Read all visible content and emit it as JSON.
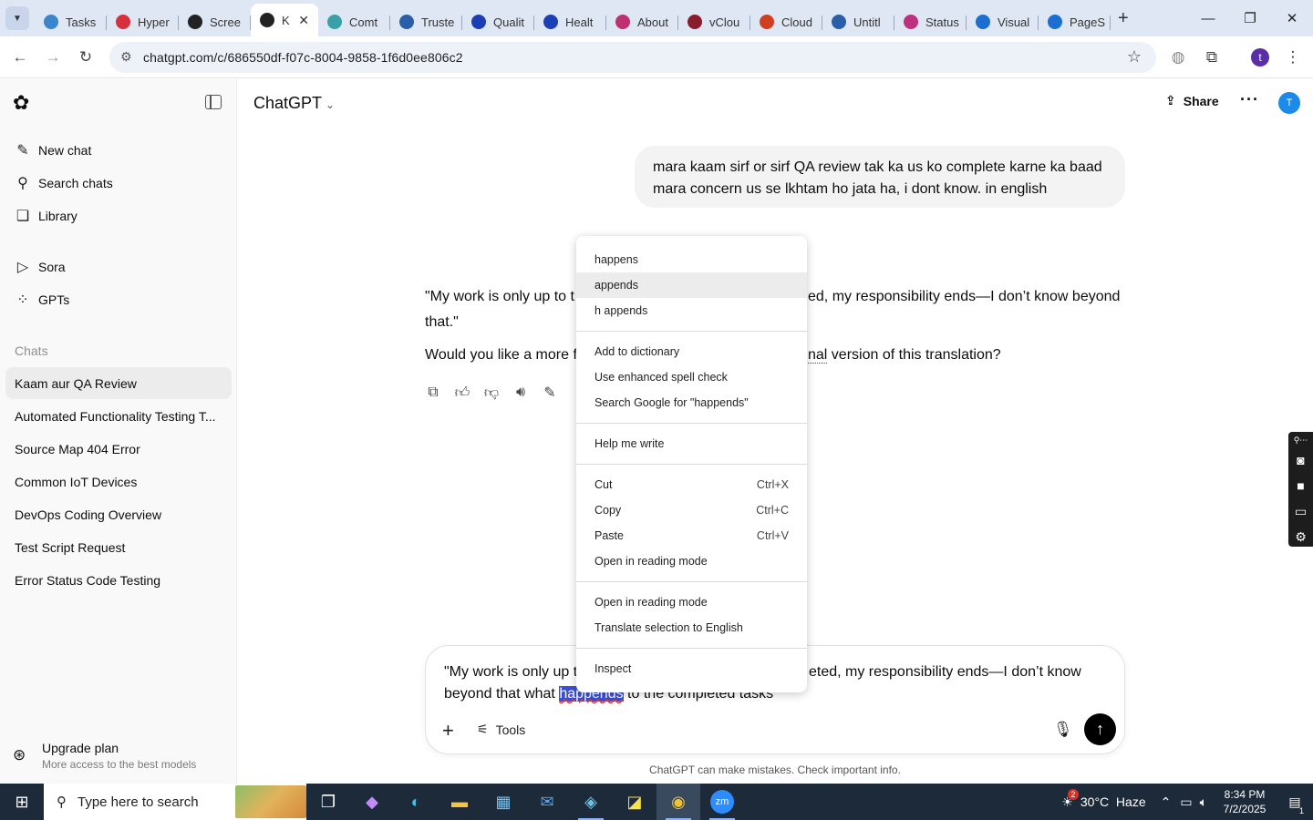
{
  "browser": {
    "tabs": [
      {
        "label": "Tasks",
        "icon": "gear-icon",
        "color": "#3a86c8"
      },
      {
        "label": "Hyper",
        "icon": "diamond-icon",
        "color": "#d62f3d"
      },
      {
        "label": "Scree",
        "icon": "screen-icon",
        "color": "#222222"
      },
      {
        "label": "K",
        "icon": "chatgpt-icon",
        "color": "#222222",
        "active": true
      },
      {
        "label": "Comt",
        "icon": "circle-icon",
        "color": "#3aa0a8"
      },
      {
        "label": "Truste",
        "icon": "scale-icon",
        "color": "#2b5ea8"
      },
      {
        "label": "Qualit",
        "icon": "x-icon",
        "color": "#1c3fb5"
      },
      {
        "label": "Healt",
        "icon": "check-icon",
        "color": "#1c3fb5"
      },
      {
        "label": "About",
        "icon": "fox-icon",
        "color": "#c0306e"
      },
      {
        "label": "vClou",
        "icon": "v-icon",
        "color": "#8a1d2b"
      },
      {
        "label": "Cloud",
        "icon": "slash-icon",
        "color": "#d04020"
      },
      {
        "label": "Untitl",
        "icon": "doc-icon",
        "color": "#2b5ea8"
      },
      {
        "label": "Status",
        "icon": "pen-icon",
        "color": "#c03080"
      },
      {
        "label": "Visual",
        "icon": "pulse-icon",
        "color": "#1c6fd0"
      },
      {
        "label": "PageS",
        "icon": "gauge-icon",
        "color": "#1c6fd0"
      }
    ],
    "url": "chatgpt.com/c/686550df-f07c-8004-9858-1f6d0ee806c2",
    "profile_initial": "t"
  },
  "sidebar": {
    "nav": [
      {
        "label": "New chat",
        "icon": "pencil-icon"
      },
      {
        "label": "Search chats",
        "icon": "search-icon"
      },
      {
        "label": "Library",
        "icon": "library-icon"
      },
      {
        "label": "Sora",
        "icon": "play-icon"
      },
      {
        "label": "GPTs",
        "icon": "grid-icon"
      }
    ],
    "chats_heading": "Chats",
    "chats": [
      "Kaam aur QA Review",
      "Automated Functionality Testing T...",
      "Source Map 404 Error",
      "Common IoT Devices",
      "DevOps Coding Overview",
      "Test Script Request",
      "Error Status Code Testing"
    ],
    "upgrade": {
      "title": "Upgrade plan",
      "subtitle": "More access to the best models"
    }
  },
  "header": {
    "title": "ChatGPT",
    "share_label": "Share",
    "avatar_initial": "T"
  },
  "conversation": {
    "user_message": {
      "line1": "mara kaam sirf or sirf QA review tak ka us ko complete karne ka baad",
      "line2": "mara concern us se lkhtam ho jata ha, i dont know. in english"
    },
    "assistant": {
      "line1_left": "\"My work is only up to t",
      "line1_right": "ed, my responsibility ends—I don’t know beyond",
      "line2": "that.\"",
      "line3_left": "Would you like a more f",
      "line3_right_dotted": "nal",
      "line3_right": " version of this translation?"
    }
  },
  "composer": {
    "line1_left": "\"My work is only up t",
    "line1_right": "eted, my responsibility ends—I don’t know",
    "line2_before": "beyond that what ",
    "line2_selected": "happends",
    "line2_after": " to the completed tasks",
    "tools_label": "Tools",
    "disclaimer": "ChatGPT can make mistakes. Check important info."
  },
  "context_menu": {
    "suggestions": [
      "happens",
      "appends",
      "h appends"
    ],
    "spell": [
      "Add to dictionary",
      "Use enhanced spell check",
      "Search Google for \"happends\""
    ],
    "help": "Help me write",
    "edit": [
      {
        "label": "Cut",
        "shortcut": "Ctrl+X"
      },
      {
        "label": "Copy",
        "shortcut": "Ctrl+C"
      },
      {
        "label": "Paste",
        "shortcut": "Ctrl+V"
      },
      {
        "label": "Open in reading mode",
        "shortcut": ""
      }
    ],
    "more": [
      "Open in reading mode",
      "Translate selection to English"
    ],
    "inspect": "Inspect"
  },
  "taskbar": {
    "search_placeholder": "Type here to search",
    "weather": "30°C  Haze",
    "weather_badge": "2",
    "time": "8:34 PM",
    "date": "7/2/2025",
    "notif_count": "1"
  }
}
